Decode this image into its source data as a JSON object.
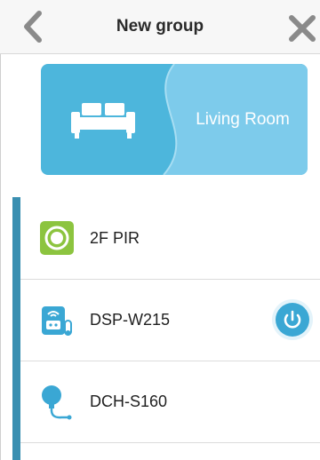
{
  "header": {
    "title": "New group",
    "back_icon": "chevron-left-icon",
    "close_icon": "close-icon"
  },
  "room": {
    "label": "Living Room",
    "icon": "sofa-icon",
    "color_dark": "#4db6dc",
    "color_light": "#7dcbeb"
  },
  "devices": [
    {
      "name": "2F PIR",
      "icon": "motion-sensor-icon",
      "has_power_toggle": false
    },
    {
      "name": "DSP-W215",
      "icon": "smart-plug-icon",
      "has_power_toggle": true
    },
    {
      "name": "DCH-S160",
      "icon": "water-sensor-icon",
      "has_power_toggle": false
    }
  ],
  "colors": {
    "accent": "#3a8fb1",
    "pir_green": "#8cc43f",
    "power_blue": "#3aa7d4"
  }
}
